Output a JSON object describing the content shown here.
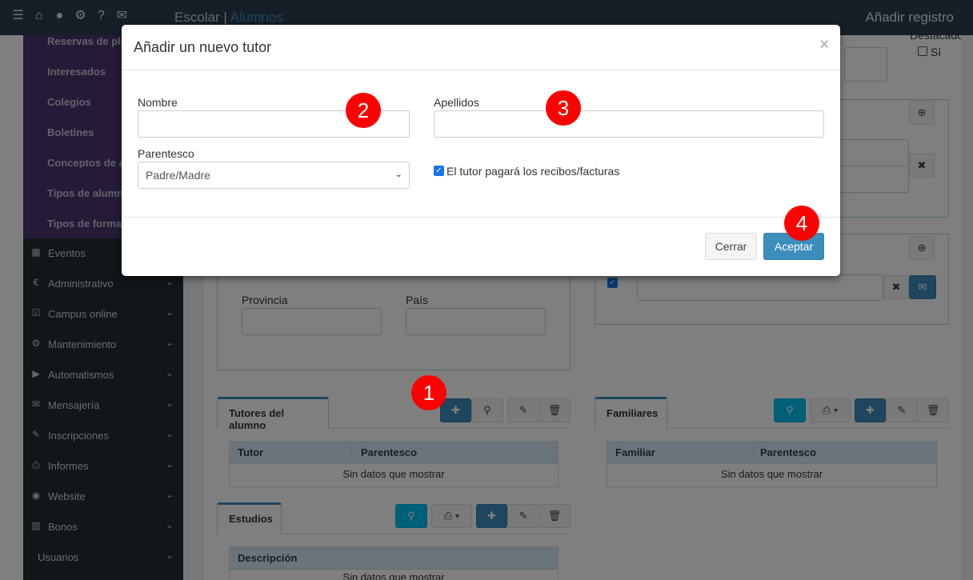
{
  "topbar": {
    "section": "Escolar",
    "separator": "|",
    "current": "Alumnos",
    "right_title": "Añadir registro",
    "icons": [
      "list-icon",
      "home-icon",
      "user-icon",
      "gear-icon",
      "help-icon",
      "chat-icon"
    ]
  },
  "sidebar": {
    "submenu": [
      "Reservas de plazas",
      "Interesados",
      "Colegios",
      "Boletines",
      "Conceptos de alumnos",
      "Tipos de alumnos",
      "Tipos de formación"
    ],
    "items": [
      {
        "label": "Eventos",
        "icon": "calendar-icon",
        "glyph": "▦",
        "chevron": false
      },
      {
        "label": "Administrativo",
        "icon": "euro-icon",
        "glyph": "€",
        "chevron": true
      },
      {
        "label": "Campus online",
        "icon": "check-square-icon",
        "glyph": "☑",
        "chevron": true
      },
      {
        "label": "Mantenimiento",
        "icon": "gear-icon",
        "glyph": "⚙",
        "chevron": true
      },
      {
        "label": "Automatismos",
        "icon": "play-icon",
        "glyph": "▶",
        "chevron": true
      },
      {
        "label": "Mensajería",
        "icon": "envelope-icon",
        "glyph": "✉",
        "chevron": true
      },
      {
        "label": "Inscripciones",
        "icon": "pencil-icon",
        "glyph": "✎",
        "chevron": true
      },
      {
        "label": "Informes",
        "icon": "print-icon",
        "glyph": "⎙",
        "chevron": true
      },
      {
        "label": "Website",
        "icon": "globe-icon",
        "glyph": "◉",
        "chevron": true
      },
      {
        "label": "Bonos",
        "icon": "barcode-icon",
        "glyph": "▥",
        "chevron": true
      },
      {
        "label": "Usuarios",
        "icon": "",
        "glyph": "",
        "chevron": true
      }
    ]
  },
  "background": {
    "destacado_label": "Destacado",
    "si_label": "Sí",
    "provincia_label": "Provincia",
    "pais_label": "País",
    "tutores_tab": "Tutores del alumno",
    "tutores_grid": {
      "col1": "Tutor",
      "col2": "Parentesco",
      "empty": "Sin datos que mostrar"
    },
    "familiares_tab": "Familiares",
    "familiares_grid": {
      "col1": "Familiar",
      "col2": "Parentesco",
      "empty": "Sin datos que mostrar"
    },
    "estudios_tab": "Estudios",
    "estudios_grid": {
      "col1": "Descripción",
      "empty": "Sin datos que mostrar"
    }
  },
  "modal": {
    "title": "Añadir un nuevo tutor",
    "close": "×",
    "nombre_label": "Nombre",
    "nombre_value": "",
    "apellidos_label": "Apellidos",
    "apellidos_value": "",
    "parentesco_label": "Parentesco",
    "parentesco_value": "Padre/Madre",
    "checkbox_label": "El tutor pagará los recibos/facturas",
    "checkbox_checked": true,
    "cerrar": "Cerrar",
    "aceptar": "Aceptar"
  },
  "markers": [
    "1",
    "2",
    "3",
    "4"
  ],
  "colors": {
    "topbar": "#2c3e50",
    "sidebar": "#222d32",
    "submenu": "#4b3670",
    "primary": "#3c8dbc",
    "marker": "#ff0000"
  }
}
